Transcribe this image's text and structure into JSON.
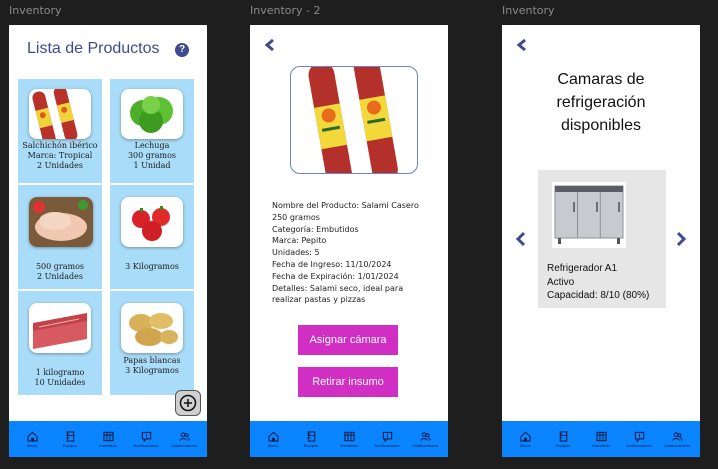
{
  "frames": [
    {
      "label": "Inventory"
    },
    {
      "label": "Inventory - 2"
    },
    {
      "label": "Inventory"
    }
  ],
  "list_screen": {
    "title": "Lista de Productos",
    "help_icon": "?",
    "products": [
      {
        "lines": [
          "Salchichón ibérico",
          "Marca: Tropical",
          "2 Unidades"
        ],
        "image": "salami"
      },
      {
        "lines": [
          "Lechuga",
          "300 gramos",
          "1 Unidad"
        ],
        "image": "lettuce"
      },
      {
        "lines": [
          "500 gramos",
          "2 Unidades"
        ],
        "image": "chicken"
      },
      {
        "lines": [
          "3 Kilogramos"
        ],
        "image": "tomatoes"
      },
      {
        "lines": [
          "1 kilogramo",
          "10 Unidades"
        ],
        "image": "beef"
      },
      {
        "lines": [
          "Papas blancas",
          "3 Kilogramos"
        ],
        "image": "potatoes"
      }
    ],
    "add_icon": "plus-circle-icon"
  },
  "detail_screen": {
    "details": [
      "Nombre del Producto: Salami Casero",
      "250 gramos",
      "Categoría: Embutidos",
      "Marca: Pepito",
      "Unidades: 5",
      "Fecha de Ingreso: 11/10/2024",
      "Fecha de Expiración: 1/01/2024",
      "Detalles: Salami seco, ideal para",
      "realizar pastas y pizzas"
    ],
    "assign_button": "Asignar cámara",
    "withdraw_button": "Retirar insumo"
  },
  "cameras_screen": {
    "title_lines": [
      "Camaras de",
      "refrigeración",
      "disponibles"
    ],
    "fridge": {
      "name": "Refrigerador A1",
      "status": "Activo",
      "capacity": "Capacidad: 8/10 (80%)"
    }
  },
  "navbar": {
    "items": [
      {
        "label": "Menú",
        "icon": "home-icon"
      },
      {
        "label": "Equipos",
        "icon": "fridge-icon"
      },
      {
        "label": "Inventario",
        "icon": "table-icon"
      },
      {
        "label": "Notificaciones",
        "icon": "alert-icon"
      },
      {
        "label": "Colaboradores",
        "icon": "users-icon"
      }
    ]
  },
  "colors": {
    "accent_blue": "#0a84ff",
    "title_blue": "#3f4a8f",
    "card_blue": "#a9dcf8",
    "button_pink": "#d12fc3"
  }
}
